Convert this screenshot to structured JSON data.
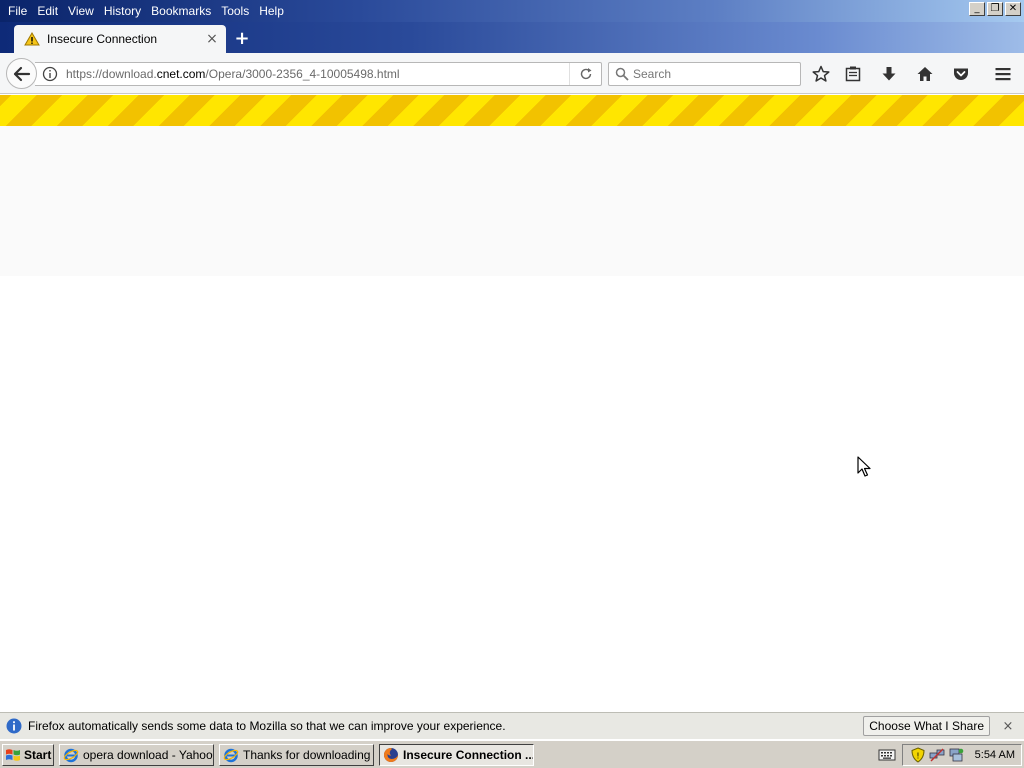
{
  "menu": {
    "items": [
      {
        "label": "File"
      },
      {
        "label": "Edit"
      },
      {
        "label": "View"
      },
      {
        "label": "History"
      },
      {
        "label": "Bookmarks"
      },
      {
        "label": "Tools"
      },
      {
        "label": "Help"
      }
    ]
  },
  "window_controls": {
    "minimize": "_",
    "restore": "❐",
    "close": "✕"
  },
  "tabs": [
    {
      "title": "Insecure Connection",
      "icon": "warning-icon",
      "close": "×"
    }
  ],
  "new_tab_label": "+",
  "navbar": {
    "url_prefix": "https://download.",
    "url_host": "cnet.com",
    "url_path": "/Opera/3000-2356_4-10005498.html",
    "search_placeholder": "Search"
  },
  "notification": {
    "text": "Firefox automatically sends some data to Mozilla so that we can improve your experience.",
    "button_label": "Choose What I Share",
    "close": "×"
  },
  "taskbar": {
    "start_label": "Start",
    "tasks": [
      {
        "label": "opera download - Yahoo ...",
        "icon": "ie-icon",
        "active": false
      },
      {
        "label": "Thanks for downloading ...",
        "icon": "ie-icon",
        "active": false
      },
      {
        "label": "Insecure Connection ...",
        "icon": "firefox-icon",
        "active": true
      }
    ],
    "clock": "5:54 AM"
  },
  "colors": {
    "stripe_yellow": "#ffe600",
    "stripe_dark": "#f2c200",
    "titlebar_blue": "#0a246a"
  }
}
